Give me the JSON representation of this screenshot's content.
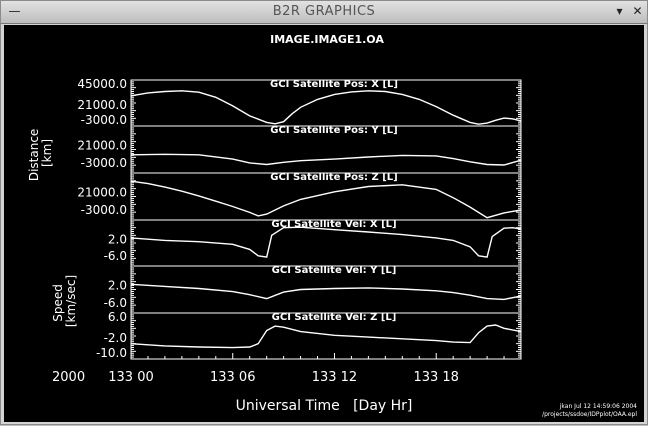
{
  "window": {
    "title": "B2R GRAPHICS",
    "menu_icon": "dash-icon",
    "minimize_icon": "down-arrow-icon",
    "close_icon": "x-icon"
  },
  "figure": {
    "title": "IMAGE.IMAGE1.OA",
    "xlabel": "Universal Time   [Day Hr]",
    "year": "2000",
    "xticks": [
      "133 00",
      "133 06",
      "133 12",
      "133 18"
    ],
    "footer": [
      "jkan Jul 12 14:59:06 2004",
      "/projects/ssdoe/IDPplot/OAA.epl"
    ],
    "group_labels": [
      {
        "line1": "Distance",
        "line2": "[km]"
      },
      {
        "line1": "Speed",
        "line2": "[km/sec]"
      }
    ],
    "colors": {
      "background": "#000000",
      "foreground": "#ffffff"
    }
  },
  "chart_data": {
    "type": "line",
    "x_unit": "day 133 hour",
    "xlim": [
      0,
      23
    ],
    "panels": [
      {
        "name": "GCI Satellite Pos: X [L]",
        "ylim": [
          -12000,
          52000
        ],
        "yticks": [
          "45000.0",
          "21000.0",
          "-3000.0"
        ],
        "x": [
          0,
          1,
          2,
          3,
          4,
          5,
          6,
          7,
          8,
          8.5,
          9,
          9.5,
          10,
          11,
          12,
          13,
          14,
          15,
          16,
          17,
          18,
          19,
          20,
          20.5,
          21,
          21.5,
          22,
          22.5,
          23
        ],
        "y": [
          30000,
          34000,
          36000,
          37000,
          35000,
          28000,
          16000,
          2000,
          -7000,
          -9000,
          -6000,
          5000,
          14000,
          25000,
          32000,
          35500,
          37000,
          36000,
          32000,
          25000,
          15000,
          3000,
          -7000,
          -9500,
          -8000,
          -4000,
          -1000,
          -2000,
          -5000
        ]
      },
      {
        "name": "GCI Satellite Pos: Y [L]",
        "ylim": [
          -14000,
          30000
        ],
        "yticks": [
          "21000.0",
          "-3000.0"
        ],
        "x": [
          0,
          2,
          4,
          6,
          7,
          8,
          9,
          10,
          12,
          14,
          16,
          18,
          19,
          20,
          21,
          22,
          23
        ],
        "y": [
          3000,
          3500,
          3000,
          -1000,
          -4500,
          -6000,
          -4000,
          -2500,
          -1000,
          1000,
          2500,
          2000,
          -500,
          -3500,
          -6000,
          -6500,
          -2000
        ]
      },
      {
        "name": "GCI Satellite Pos: Z [L]",
        "ylim": [
          -10000,
          30000
        ],
        "yticks": [
          "21000.0",
          "-3000.0"
        ],
        "x": [
          0,
          1,
          2,
          3,
          4,
          5,
          6,
          7,
          7.5,
          8,
          9,
          10,
          12,
          14,
          16,
          18,
          19,
          20,
          21,
          22,
          23
        ],
        "y": [
          23000,
          21000,
          18000,
          14500,
          10500,
          6000,
          1500,
          -3500,
          -6500,
          -5000,
          2000,
          7500,
          14000,
          18500,
          20000,
          16000,
          9000,
          1000,
          -8000,
          -4000,
          -1500
        ]
      },
      {
        "name": "GCI Satellite Vel: X [L]",
        "ylim": [
          -10000,
          8000
        ],
        "yticks": [
          "2.0",
          "-6.0"
        ],
        "x": [
          0,
          2,
          4,
          6,
          7,
          7.5,
          8,
          8.3,
          9,
          10,
          12,
          14,
          16,
          18,
          19,
          20,
          20.5,
          21,
          21.3,
          22,
          22.5,
          23
        ],
        "y": [
          1000,
          0,
          -500,
          -1500,
          -3500,
          -6000,
          -6500,
          2000,
          5000,
          5200,
          4200,
          3300,
          2300,
          1000,
          0,
          -2500,
          -6000,
          -6500,
          1500,
          4800,
          5000,
          4500
        ]
      },
      {
        "name": "GCI Satellite Vel: Y [L]",
        "ylim": [
          -10000,
          8000
        ],
        "yticks": [
          "2.0",
          "-6.0"
        ],
        "x": [
          0,
          2,
          4,
          6,
          7,
          8,
          9,
          10,
          12,
          14,
          16,
          18,
          19,
          20,
          21,
          22,
          23
        ],
        "y": [
          1000,
          200,
          -600,
          -1800,
          -3000,
          -4500,
          -2000,
          -1000,
          -600,
          -400,
          -800,
          -1500,
          -2200,
          -3200,
          -4500,
          -4800,
          -3500
        ]
      },
      {
        "name": "GCI Satellite Vel: Z [L]",
        "ylim": [
          -10000,
          11000
        ],
        "yticks": [
          "6.0",
          "-2.0",
          "-10.0"
        ],
        "x": [
          0,
          2,
          4,
          6,
          7,
          7.5,
          8,
          8.5,
          9,
          10,
          12,
          14,
          16,
          18,
          19,
          20,
          20.5,
          21,
          21.5,
          22,
          23
        ],
        "y": [
          -3000,
          -4000,
          -4500,
          -4800,
          -4500,
          -3000,
          3000,
          5000,
          4500,
          2500,
          800,
          0,
          -800,
          -1600,
          -2300,
          -2500,
          2000,
          5000,
          5500,
          4000,
          2500
        ]
      }
    ]
  }
}
